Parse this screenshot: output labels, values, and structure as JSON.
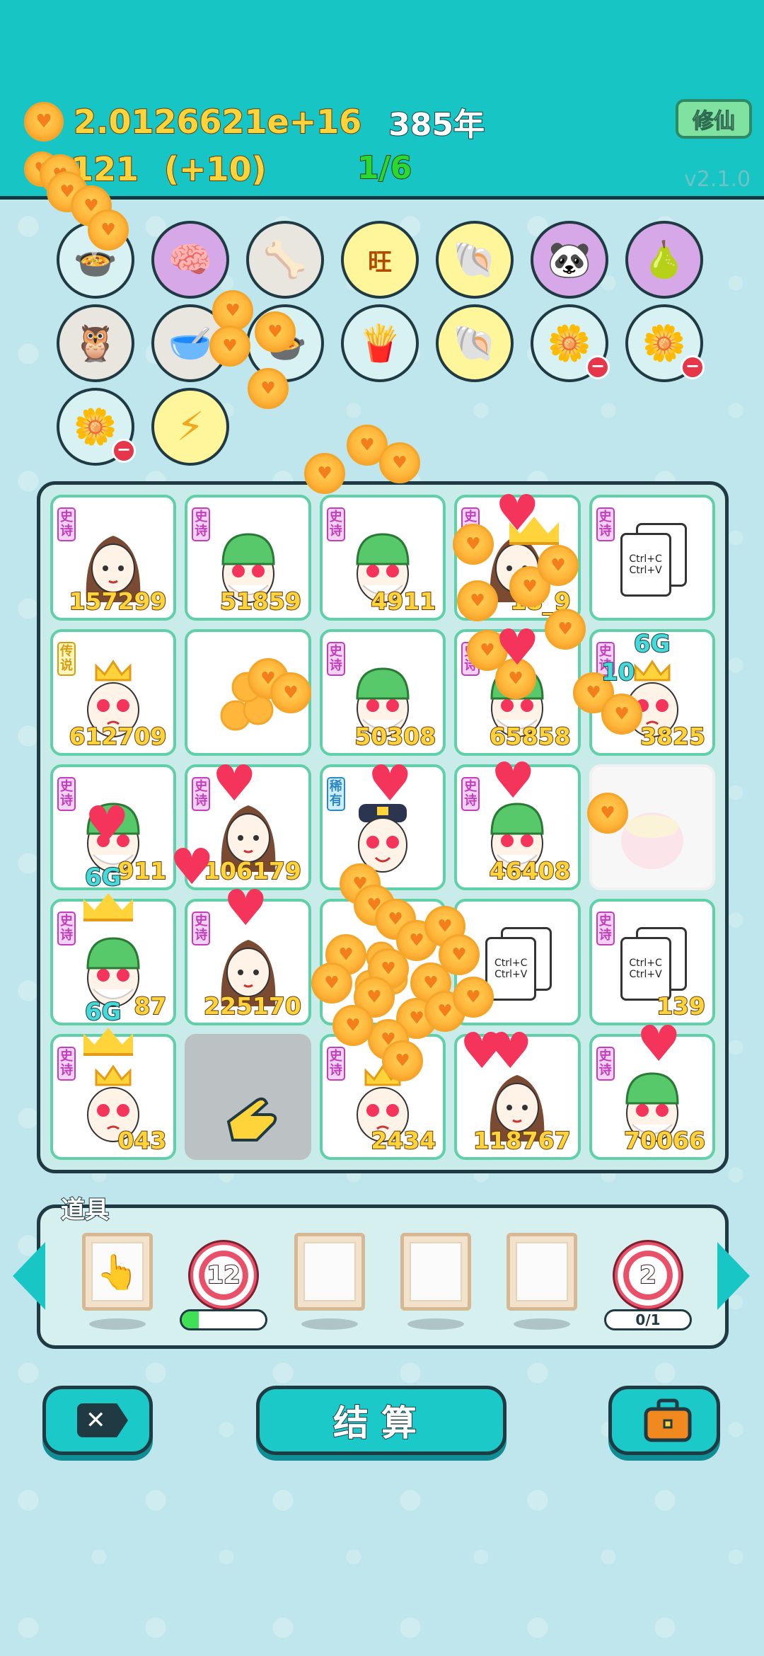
{
  "header": {
    "coins_total": "2.0126621e+16",
    "years": "385年",
    "coins_small": "121",
    "coins_rate": "(+10)",
    "level": "1/6",
    "cultivate_label": "修仙",
    "version": "v2.1.0"
  },
  "items_row": [
    "duck-pot",
    "formula-brain",
    "bone-bowl",
    "wang-sticker",
    "shell",
    "panda",
    "glasses-pear",
    "owl-mask",
    "cracked-bowl",
    "duck-pot-2",
    "french-fries",
    "shell-2",
    "flower-pot",
    "flower-pot-2",
    "flower-pot-3",
    "lightning"
  ],
  "board": {
    "tiles": [
      {
        "tag": "史诗",
        "char": "girl",
        "value": "157299"
      },
      {
        "tag": "史诗",
        "char": "green-hat",
        "value": "51859"
      },
      {
        "tag": "史诗",
        "char": "green-hat",
        "value": "4911"
      },
      {
        "tag": "史诗",
        "char": "girl",
        "value": "18_9"
      },
      {
        "tag": "史诗",
        "char": "ctrl-cv",
        "value": ""
      },
      {
        "tag": "传说",
        "char": "king",
        "value": "612709"
      },
      {
        "tag": "",
        "char": "coins",
        "value": ""
      },
      {
        "tag": "史诗",
        "char": "green-hat",
        "value": "50308"
      },
      {
        "tag": "史诗",
        "char": "green-hat",
        "value": "65858"
      },
      {
        "tag": "史诗",
        "char": "king",
        "value": "3825"
      },
      {
        "tag": "史诗",
        "char": "green-hat",
        "value": "911"
      },
      {
        "tag": "史诗",
        "char": "girl",
        "value": "106179"
      },
      {
        "tag": "稀有",
        "char": "police",
        "value": ""
      },
      {
        "tag": "史诗",
        "char": "green-hat",
        "value": "46408"
      },
      {
        "tag": "",
        "char": "bowl",
        "value": ""
      },
      {
        "tag": "史诗",
        "char": "green-hat",
        "value": "87"
      },
      {
        "tag": "史诗",
        "char": "girl",
        "value": "225170"
      },
      {
        "tag": "",
        "char": "coins",
        "value": ""
      },
      {
        "tag": "",
        "char": "ctrl-cv",
        "value": ""
      },
      {
        "tag": "史诗",
        "char": "ctrl-cv",
        "value": "139"
      },
      {
        "tag": "史诗",
        "char": "king",
        "value": "043"
      },
      {
        "tag": "",
        "char": "hand",
        "value": ""
      },
      {
        "tag": "史诗",
        "char": "king",
        "value": "2434"
      },
      {
        "tag": "",
        "char": "girl",
        "value": "118767"
      },
      {
        "tag": "史诗",
        "char": "green-hat",
        "value": "70066"
      }
    ],
    "float_labels": {
      "six_g_1": "6G",
      "six_g_2": "6G",
      "six_g_3": "6G",
      "ten": "10"
    }
  },
  "props": {
    "title": "道具",
    "timer_1": "12",
    "timer_2": "2",
    "counter_2": "0/1",
    "progress_1": 0.2
  },
  "actions": {
    "close_label": "✕",
    "settle_label": "结算",
    "bag_label": "bag"
  },
  "copy_text": {
    "line1": "Ctrl+C",
    "line2": "Ctrl+V"
  },
  "colors": {
    "accent": "#17c5c5",
    "coin": "#ffb63a",
    "epic": "#c33dbd",
    "legend": "#d69d13"
  }
}
